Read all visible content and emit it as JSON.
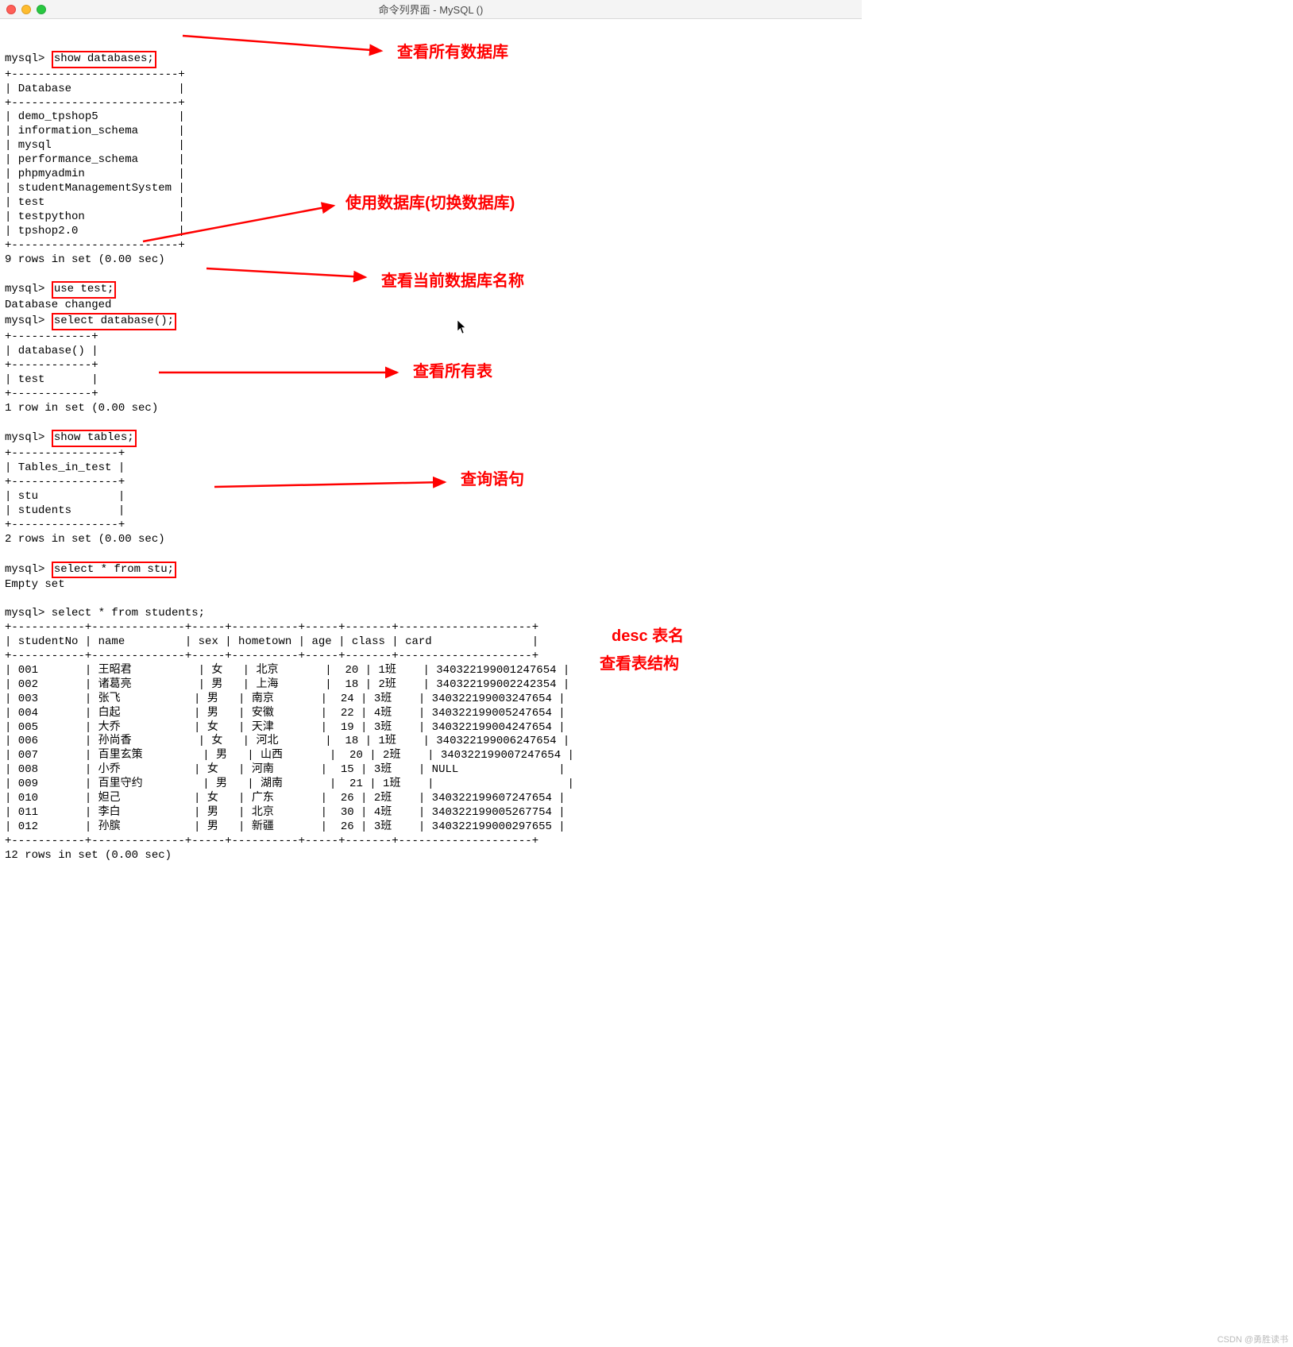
{
  "window": {
    "title": "命令列界面 - MySQL ()"
  },
  "prompt": "mysql> ",
  "commands": {
    "show_db": "show databases;",
    "use_test": "use test;",
    "db_changed": "Database changed",
    "select_db": "select database();",
    "show_tables": "show tables;",
    "select_stu": "select * from stu;",
    "empty_set": "Empty set",
    "select_students": "select * from students;"
  },
  "databases": {
    "header": "Database",
    "rows": [
      "demo_tpshop5",
      "information_schema",
      "mysql",
      "performance_schema",
      "phpmyadmin",
      "studentManagementSystem",
      "test",
      "testpython",
      "tpshop2.0"
    ],
    "footer": "9 rows in set (0.00 sec)"
  },
  "current_db": {
    "header": "database()",
    "value": "test",
    "footer": "1 row in set (0.00 sec)"
  },
  "tables": {
    "header": "Tables_in_test",
    "rows": [
      "stu",
      "students"
    ],
    "footer": "2 rows in set (0.00 sec)"
  },
  "students": {
    "headers": [
      "studentNo",
      "name",
      "sex",
      "hometown",
      "age",
      "class",
      "card"
    ],
    "rows": [
      [
        "001",
        "王昭君",
        "女",
        "北京",
        "20",
        "1班",
        "340322199001247654"
      ],
      [
        "002",
        "诸葛亮",
        "男",
        "上海",
        "18",
        "2班",
        "340322199002242354"
      ],
      [
        "003",
        "张飞",
        "男",
        "南京",
        "24",
        "3班",
        "340322199003247654"
      ],
      [
        "004",
        "白起",
        "男",
        "安徽",
        "22",
        "4班",
        "340322199005247654"
      ],
      [
        "005",
        "大乔",
        "女",
        "天津",
        "19",
        "3班",
        "340322199004247654"
      ],
      [
        "006",
        "孙尚香",
        "女",
        "河北",
        "18",
        "1班",
        "340322199006247654"
      ],
      [
        "007",
        "百里玄策",
        "男",
        "山西",
        "20",
        "2班",
        "340322199007247654"
      ],
      [
        "008",
        "小乔",
        "女",
        "河南",
        "15",
        "3班",
        "NULL"
      ],
      [
        "009",
        "百里守约",
        "男",
        "湖南",
        "21",
        "1班",
        ""
      ],
      [
        "010",
        "妲己",
        "女",
        "广东",
        "26",
        "2班",
        "340322199607247654"
      ],
      [
        "011",
        "李白",
        "男",
        "北京",
        "30",
        "4班",
        "340322199005267754"
      ],
      [
        "012",
        "孙膑",
        "男",
        "新疆",
        "26",
        "3班",
        "340322199000297655"
      ]
    ],
    "footer": "12 rows in set (0.00 sec)"
  },
  "annotations": {
    "a1": "查看所有数据库",
    "a2": "使用数据库(切换数据库)",
    "a3": "查看当前数据库名称",
    "a4": "查看所有表",
    "a5": "查询语句",
    "a6_l1": "desc 表名",
    "a6_l2": "查看表结构"
  },
  "watermark": "CSDN @勇胜读书"
}
